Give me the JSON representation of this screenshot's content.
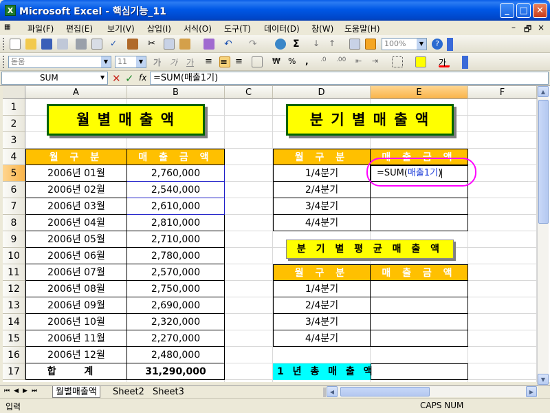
{
  "window": {
    "title": "Microsoft Excel - 핵심기능_11",
    "app_icon": "X"
  },
  "menu": {
    "items": [
      "파일(F)",
      "편집(E)",
      "보기(V)",
      "삽입(I)",
      "서식(O)",
      "도구(T)",
      "데이터(D)",
      "창(W)",
      "도움말(H)"
    ],
    "mdi": [
      "–",
      "🗗",
      "×"
    ]
  },
  "toolbar": {
    "zoom": "100%",
    "font_name": "돋움",
    "font_size": "11",
    "sigma": "Σ",
    "won": "₩",
    "percent": "%",
    "comma": ",",
    "bold_ga": "가",
    "italic_ga": "가",
    "under_ga": "가",
    "font_color_ga": "가"
  },
  "formula_bar": {
    "name_box": "SUM",
    "cancel": "✕",
    "enter": "✓",
    "fx": "fx",
    "formula": "=SUM(매출1기)"
  },
  "columns": [
    "A",
    "B",
    "C",
    "D",
    "E",
    "F"
  ],
  "rows": [
    "1",
    "2",
    "3",
    "4",
    "5",
    "6",
    "7",
    "8",
    "9",
    "10",
    "11",
    "12",
    "13",
    "14",
    "15",
    "16",
    "17"
  ],
  "sheet": {
    "monthly_title": "월 별 매 출 액",
    "quarterly_title": "분 기 별 매 출 액",
    "average_title": "분 기 별 평 균 매 출 액",
    "annual_title": "1 년 총 매 출 액",
    "hdr_month": "월 구 분",
    "hdr_sales": "매 출 금 액",
    "months": [
      {
        "month": "2006년 01월",
        "sales": "2,760,000"
      },
      {
        "month": "2006년 02월",
        "sales": "2,540,000"
      },
      {
        "month": "2006년 03월",
        "sales": "2,610,000"
      },
      {
        "month": "2006년 04월",
        "sales": "2,810,000"
      },
      {
        "month": "2006년 05월",
        "sales": "2,710,000"
      },
      {
        "month": "2006년 06월",
        "sales": "2,780,000"
      },
      {
        "month": "2006년 07월",
        "sales": "2,570,000"
      },
      {
        "month": "2006년 08월",
        "sales": "2,750,000"
      },
      {
        "month": "2006년 09월",
        "sales": "2,690,000"
      },
      {
        "month": "2006년 10월",
        "sales": "2,320,000"
      },
      {
        "month": "2006년 11월",
        "sales": "2,270,000"
      },
      {
        "month": "2006년 12월",
        "sales": "2,480,000"
      }
    ],
    "total_label": "합 계",
    "total_value": "31,290,000",
    "quarters": [
      "1/4분기",
      "2/4분기",
      "3/4분기",
      "4/4분기"
    ],
    "editing_cell": {
      "prefix": "=SUM(",
      "range": "매출1기",
      "suffix": ")"
    }
  },
  "tabs": [
    "월별매출액",
    "Sheet2",
    "Sheet3"
  ],
  "status": {
    "mode": "입력",
    "indicators": "CAPS NUM"
  }
}
